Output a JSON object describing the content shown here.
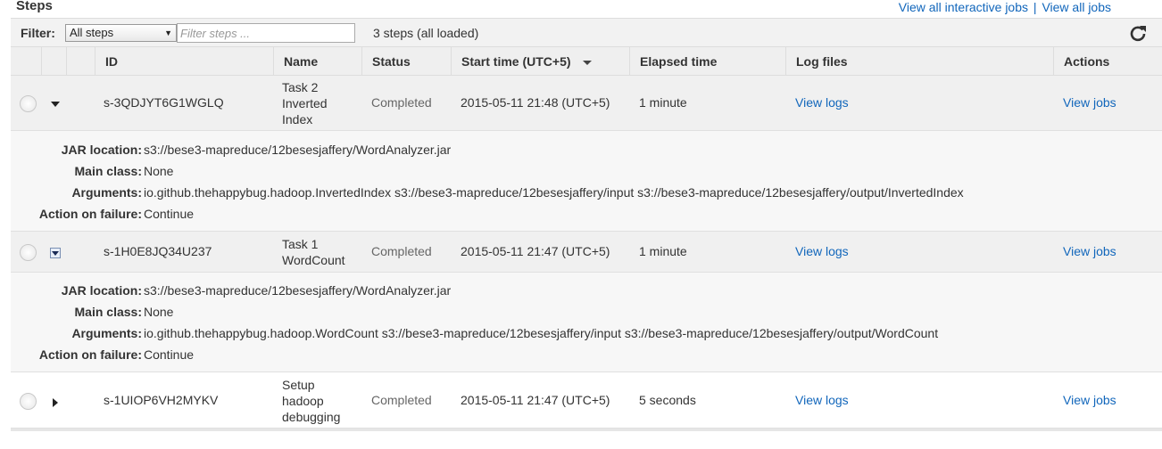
{
  "header": {
    "title": "Steps",
    "link_interactive": "View all interactive jobs",
    "separator": "|",
    "link_all": "View all jobs"
  },
  "filter": {
    "label": "Filter:",
    "select_value": "All steps",
    "placeholder": "Filter steps ...",
    "count_text": "3 steps (all loaded)"
  },
  "columns": {
    "id": "ID",
    "name": "Name",
    "status": "Status",
    "start": "Start time (UTC+5)",
    "elapsed": "Elapsed time",
    "logs": "Log files",
    "actions": "Actions"
  },
  "detail_labels": {
    "jar": "JAR location:",
    "main": "Main class:",
    "args": "Arguments:",
    "failure": "Action on failure:"
  },
  "steps": [
    {
      "id": "s-3QDJYT6G1WGLQ",
      "name_lines": [
        "Task 2",
        "Inverted",
        "Index"
      ],
      "status": "Completed",
      "start": "2015-05-11 21:48 (UTC+5)",
      "elapsed": "1 minute",
      "logs": "View logs",
      "action": "View jobs",
      "expanded": true,
      "jar": "s3://bese3-mapreduce/12besesjaffery/WordAnalyzer.jar",
      "main_class": "None",
      "arguments": "io.github.thehappybug.hadoop.InvertedIndex s3://bese3-mapreduce/12besesjaffery/input s3://bese3-mapreduce/12besesjaffery/output/InvertedIndex",
      "failure": "Continue"
    },
    {
      "id": "s-1H0E8JQ34U237",
      "name_lines": [
        "Task 1",
        "WordCount"
      ],
      "status": "Completed",
      "start": "2015-05-11 21:47 (UTC+5)",
      "elapsed": "1 minute",
      "logs": "View logs",
      "action": "View jobs",
      "expanded": true,
      "jar": "s3://bese3-mapreduce/12besesjaffery/WordAnalyzer.jar",
      "main_class": "None",
      "arguments": "io.github.thehappybug.hadoop.WordCount s3://bese3-mapreduce/12besesjaffery/input s3://bese3-mapreduce/12besesjaffery/output/WordCount",
      "failure": "Continue"
    },
    {
      "id": "s-1UIOP6VH2MYKV",
      "name_lines": [
        "Setup",
        "hadoop",
        "debugging"
      ],
      "status": "Completed",
      "start": "2015-05-11 21:47 (UTC+5)",
      "elapsed": "5 seconds",
      "logs": "View logs",
      "action": "View jobs",
      "expanded": false
    }
  ]
}
